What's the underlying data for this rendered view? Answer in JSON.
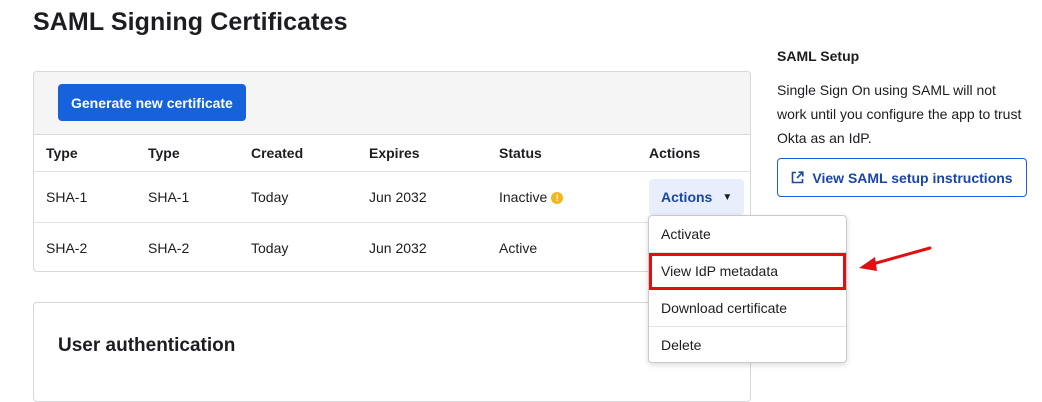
{
  "page": {
    "title": "SAML Signing Certificates"
  },
  "cert": {
    "generate_label": "Generate new certificate",
    "columns": [
      "Type",
      "Type",
      "Created",
      "Expires",
      "Status",
      "Actions"
    ],
    "rows": [
      {
        "type1": "SHA-1",
        "type2": "SHA-1",
        "created": "Today",
        "expires": "Jun 2032",
        "status": "Inactive",
        "actions_label": "Actions"
      },
      {
        "type1": "SHA-2",
        "type2": "SHA-2",
        "created": "Today",
        "expires": "Jun 2032",
        "status": "Active"
      }
    ]
  },
  "dropdown": {
    "items": [
      "Activate",
      "View IdP metadata",
      "Download certificate",
      "Delete"
    ],
    "highlighted_index": 1,
    "highlight_color": "#e01010"
  },
  "auth": {
    "title": "User authentication"
  },
  "side": {
    "title": "SAML Setup",
    "text": "Single Sign On using SAML will not work until you configure the app to trust Okta as an IdP.",
    "button_label": "View SAML setup instructions"
  },
  "icons": {
    "warning": "warning-icon",
    "caret": "caret-down-icon",
    "external": "external-link-icon",
    "arrow": "red-arrow-annotation"
  },
  "colors": {
    "primary": "#1662dd",
    "warning": "#f3b71a",
    "annotation": "#e01010"
  }
}
